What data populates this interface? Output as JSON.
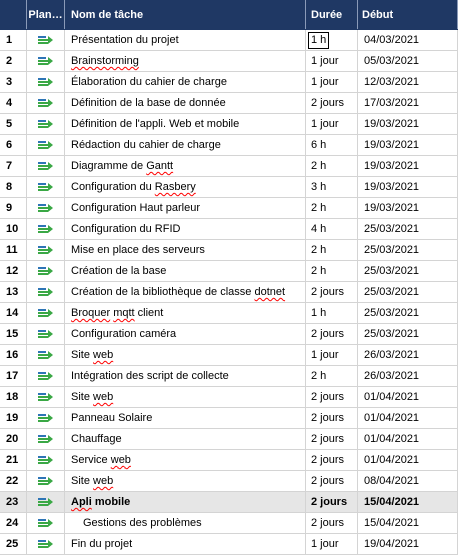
{
  "headers": {
    "id": "",
    "mode": "Plan…",
    "name": "Nom de tâche",
    "duration": "Durée",
    "start": "Début"
  },
  "icons": {
    "mode": "auto-scheduled-task-icon"
  },
  "colors": {
    "header_bg": "#1f3864",
    "summary_bg": "#e6e6e6",
    "icon_blue": "#2e75b6",
    "icon_green": "#3aa845"
  },
  "rows": [
    {
      "id": "1",
      "name": "Présentation du projet",
      "duration": "1 h",
      "start": "04/03/2021"
    },
    {
      "id": "2",
      "name": "Brainstorming",
      "duration": "1 jour",
      "start": "05/03/2021"
    },
    {
      "id": "3",
      "name": "Élaboration du cahier de charge",
      "duration": "1 jour",
      "start": "12/03/2021"
    },
    {
      "id": "4",
      "name": "Définition de la base de donnée",
      "duration": "2 jours",
      "start": "17/03/2021"
    },
    {
      "id": "5",
      "name": "Définition de l'appli. Web et mobile",
      "duration": "1 jour",
      "start": "19/03/2021"
    },
    {
      "id": "6",
      "name": "Rédaction du cahier de charge",
      "duration": "6 h",
      "start": "19/03/2021"
    },
    {
      "id": "7",
      "name": "Diagramme de Gantt",
      "duration": "2 h",
      "start": "19/03/2021"
    },
    {
      "id": "8",
      "name": "Configuration du Rasbery",
      "duration": "3 h",
      "start": "19/03/2021"
    },
    {
      "id": "9",
      "name": "Configuration Haut parleur",
      "duration": "2 h",
      "start": "19/03/2021"
    },
    {
      "id": "10",
      "name": "Configuration du RFID",
      "duration": "4 h",
      "start": "25/03/2021"
    },
    {
      "id": "11",
      "name": "Mise en place des serveurs",
      "duration": "2 h",
      "start": "25/03/2021"
    },
    {
      "id": "12",
      "name": "Création de la base",
      "duration": "2 h",
      "start": "25/03/2021"
    },
    {
      "id": "13",
      "name": "Création de la bibliothèque de classe dotnet",
      "duration": "2 jours",
      "start": "25/03/2021"
    },
    {
      "id": "14",
      "name": "Broquer mqtt client",
      "duration": "1 h",
      "start": "25/03/2021"
    },
    {
      "id": "15",
      "name": "Configuration caméra",
      "duration": "2 jours",
      "start": "25/03/2021"
    },
    {
      "id": "16",
      "name": "Site web",
      "duration": "1 jour",
      "start": "26/03/2021"
    },
    {
      "id": "17",
      "name": "Intégration des script de collecte",
      "duration": "2 h",
      "start": "26/03/2021"
    },
    {
      "id": "18",
      "name": "Site web",
      "duration": "2 jours",
      "start": "01/04/2021"
    },
    {
      "id": "19",
      "name": "Panneau Solaire",
      "duration": "2 jours",
      "start": "01/04/2021"
    },
    {
      "id": "20",
      "name": "Chauffage",
      "duration": "2 jours",
      "start": "01/04/2021"
    },
    {
      "id": "21",
      "name": "Service web",
      "duration": "2 jours",
      "start": "01/04/2021"
    },
    {
      "id": "22",
      "name": "Site web",
      "duration": "2 jours",
      "start": "08/04/2021"
    },
    {
      "id": "23",
      "name": "Apli mobile",
      "duration": "2 jours",
      "start": "15/04/2021"
    },
    {
      "id": "24",
      "name": "Gestions des problèmes",
      "duration": "2 jours",
      "start": "15/04/2021"
    },
    {
      "id": "25",
      "name": "Fin du projet",
      "duration": "1 jour",
      "start": "19/04/2021"
    }
  ]
}
